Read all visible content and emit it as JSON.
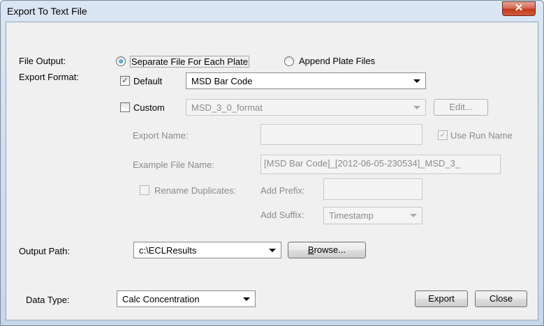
{
  "window": {
    "title": "Export To Text File",
    "close_glyph": "✕"
  },
  "file_output": {
    "label": "File Output:",
    "option_separate": "Separate File For Each Plate",
    "option_append": "Append Plate Files"
  },
  "export_format": {
    "label": "Export Format:",
    "default_label": "Default",
    "default_value": "MSD Bar Code",
    "custom_label": "Custom",
    "custom_value": "MSD_3_0_format",
    "edit_button": "Edit..."
  },
  "custom": {
    "export_name_label": "Export Name:",
    "export_name_value": "",
    "use_run_name_label": "Use Run Name",
    "example_file_name_label": "Example File Name:",
    "example_file_name_value": "[MSD Bar Code]_[2012-06-05-230534]_MSD_3_",
    "rename_duplicates_label": "Rename Duplicates:",
    "add_prefix_label": "Add Prefix:",
    "add_prefix_value": "",
    "add_suffix_label": "Add Suffix:",
    "add_suffix_value": "Timestamp"
  },
  "output_path": {
    "label": "Output Path:",
    "value": "c:\\ECLResults",
    "browse_button_underline": "B",
    "browse_button_rest": "rowse..."
  },
  "data_type": {
    "label": "Data Type:",
    "value": "Calc Concentration"
  },
  "buttons": {
    "export": "Export",
    "close": "Close"
  }
}
